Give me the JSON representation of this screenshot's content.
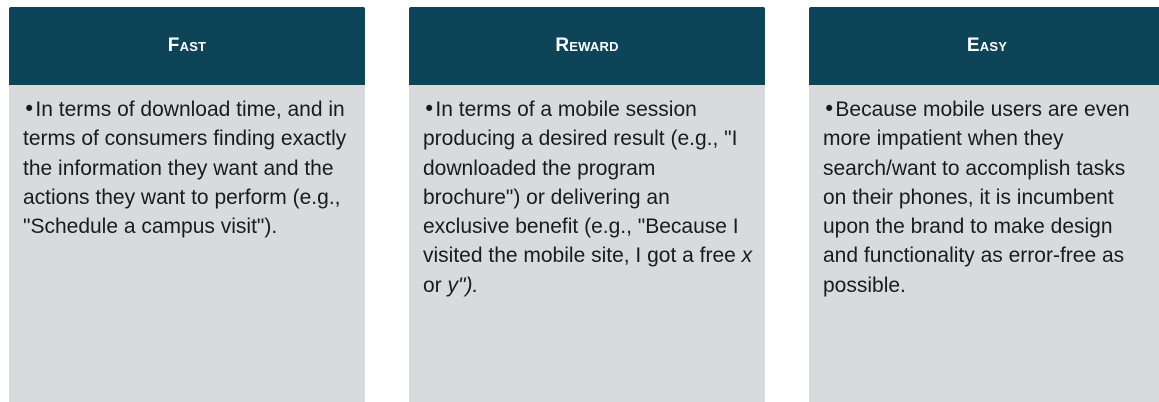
{
  "cards": [
    {
      "title": "Fast",
      "text": "In terms of download time, and in terms of consumers finding exactly the information they want and the actions they want to perform (e.g., \"Schedule a campus visit\")."
    },
    {
      "title": "Reward",
      "text_main": "In terms of a mobile session producing a desired result (e.g., \"I downloaded the program brochure\") or delivering an exclusive benefit (e.g., \"Because I visited the mobile site, I got a free ",
      "text_x": "x",
      "text_or": " or ",
      "text_y_end": "y\")."
    },
    {
      "title": "Easy",
      "text": "Because mobile users are even more impatient when they search/want to accomplish tasks on their phones, it is incumbent upon the brand to make design and functionality as error-free as possible."
    }
  ],
  "bullet": "•",
  "colors": {
    "header_bg": "#0e4458",
    "body_bg": "#d9dadb",
    "header_text": "#ffffff",
    "body_text": "#1a1a1a"
  }
}
